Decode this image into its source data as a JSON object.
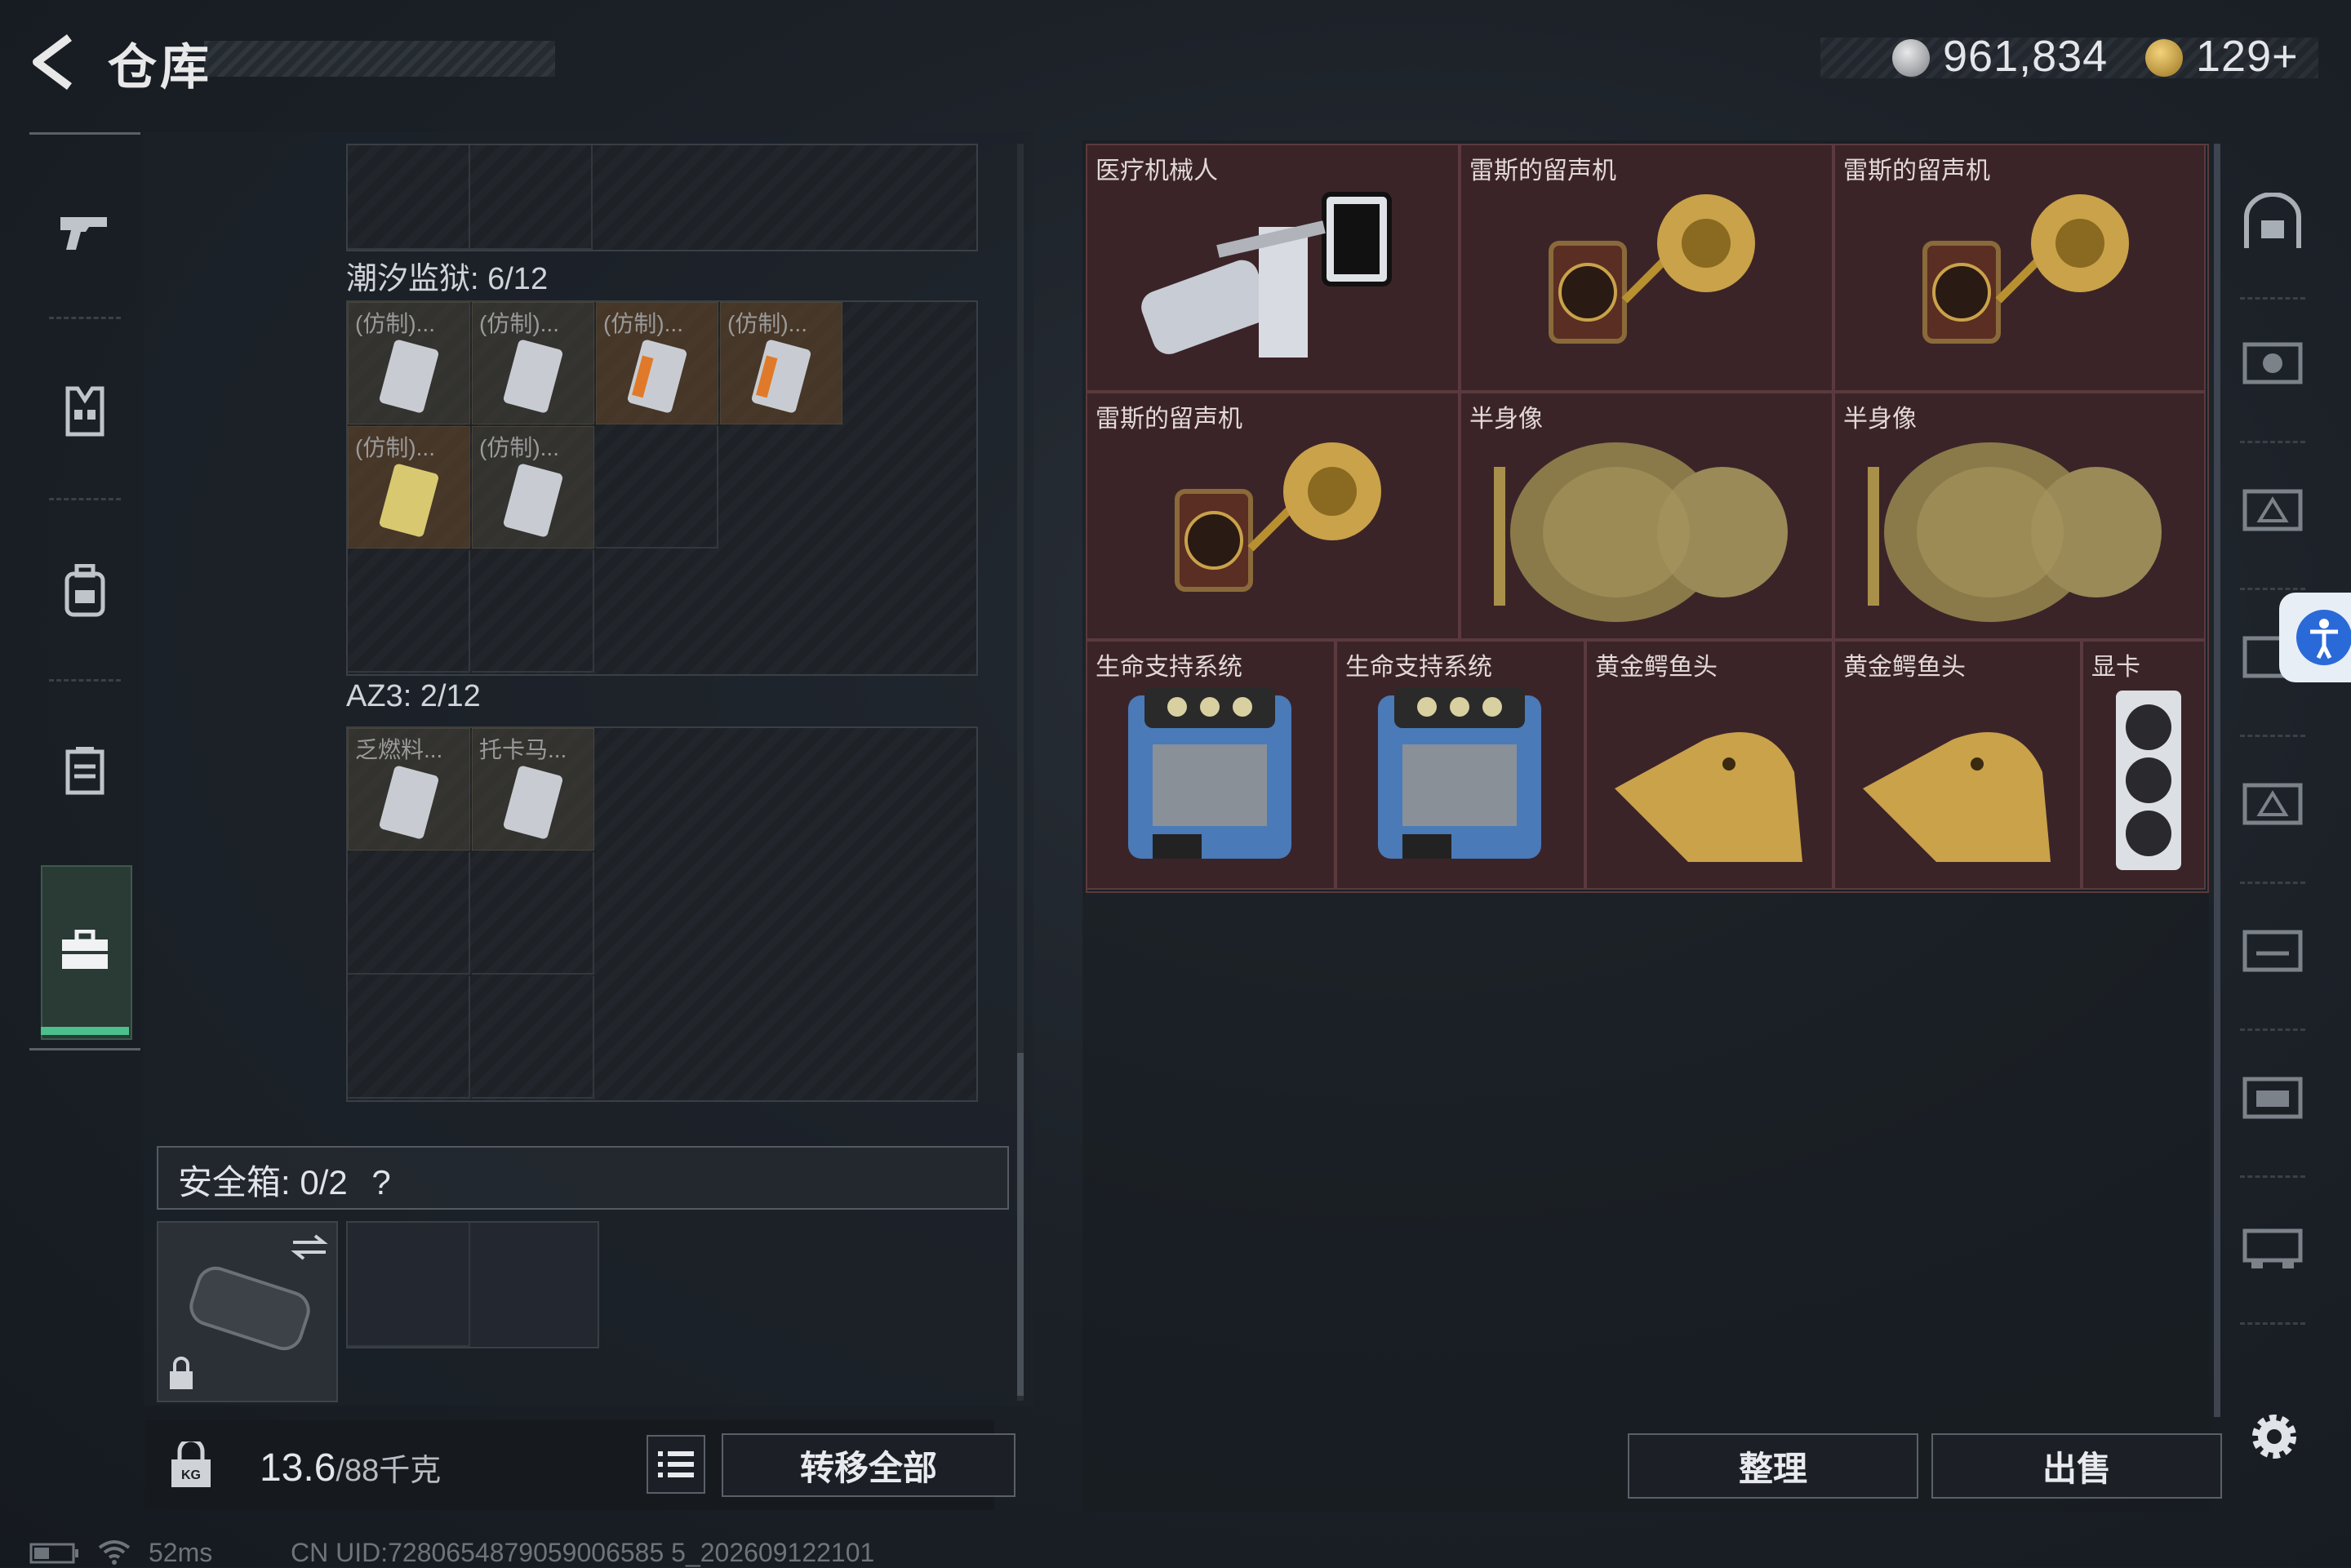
{
  "header": {
    "title": "仓库",
    "currency_silver": "961,834",
    "currency_gold": "129+"
  },
  "sections": {
    "tide_prison": {
      "title": "潮汐监狱: 6/12",
      "items": [
        "(仿制)...",
        "(仿制)...",
        "(仿制)...",
        "(仿制)...",
        "(仿制)...",
        "(仿制)..."
      ]
    },
    "az3": {
      "title": "AZ3: 2/12",
      "items": [
        "乏燃料...",
        "托卡马..."
      ]
    }
  },
  "safe_box": {
    "label": "安全箱:",
    "value": "0/2",
    "help": "?"
  },
  "weight": {
    "current": "13.6",
    "max": "/88千克"
  },
  "buttons": {
    "transfer_all": "转移全部",
    "sort": "整理",
    "sell": "出售"
  },
  "storage_items": [
    "医疗机械人",
    "雷斯的留声机",
    "雷斯的留声机",
    "雷斯的留声机",
    "半身像",
    "半身像",
    "生命支持系统",
    "生命支持系统",
    "黄金鳄鱼头",
    "黄金鳄鱼头",
    "显卡"
  ],
  "status": {
    "ping": "52ms",
    "uid": "CN UID:7280654879059006585 5_202609122101"
  },
  "colors": {
    "accent": "#4cc08a",
    "item_bg": "#3b2428",
    "gold": "#c9a24a"
  },
  "icons": [
    "back-arrow-icon",
    "silver-coin-icon",
    "gold-coin-icon",
    "pistol-icon",
    "vest-icon",
    "backpack-icon",
    "container-icon",
    "toolbox-icon",
    "lock-icon",
    "weight-lock-icon",
    "list-icon",
    "settings-icon",
    "accessibility-icon",
    "battery-icon",
    "wifi-icon",
    "swap-icon"
  ]
}
